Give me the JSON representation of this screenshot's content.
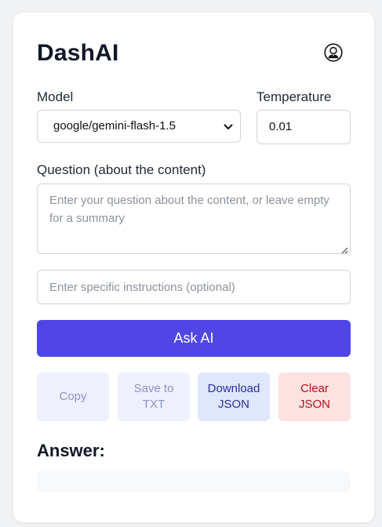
{
  "app": {
    "title": "DashAI",
    "avatar_icon": "user-avatar-icon"
  },
  "model": {
    "label": "Model",
    "selected": "google/gemini-flash-1.5"
  },
  "temperature": {
    "label": "Temperature",
    "value": "0.01"
  },
  "question": {
    "label": "Question (about the content)",
    "placeholder": "Enter your question about the content, or leave empty for a summary",
    "value": ""
  },
  "instructions": {
    "placeholder": "Enter specific instructions (optional)",
    "value": ""
  },
  "ask_button": {
    "label": "Ask AI",
    "color": "#4f46e5"
  },
  "actions": {
    "copy": "Copy",
    "save": "Save to TXT",
    "download": "Download JSON",
    "clear": "Clear JSON"
  },
  "answer": {
    "heading": "Answer:",
    "text": ""
  }
}
